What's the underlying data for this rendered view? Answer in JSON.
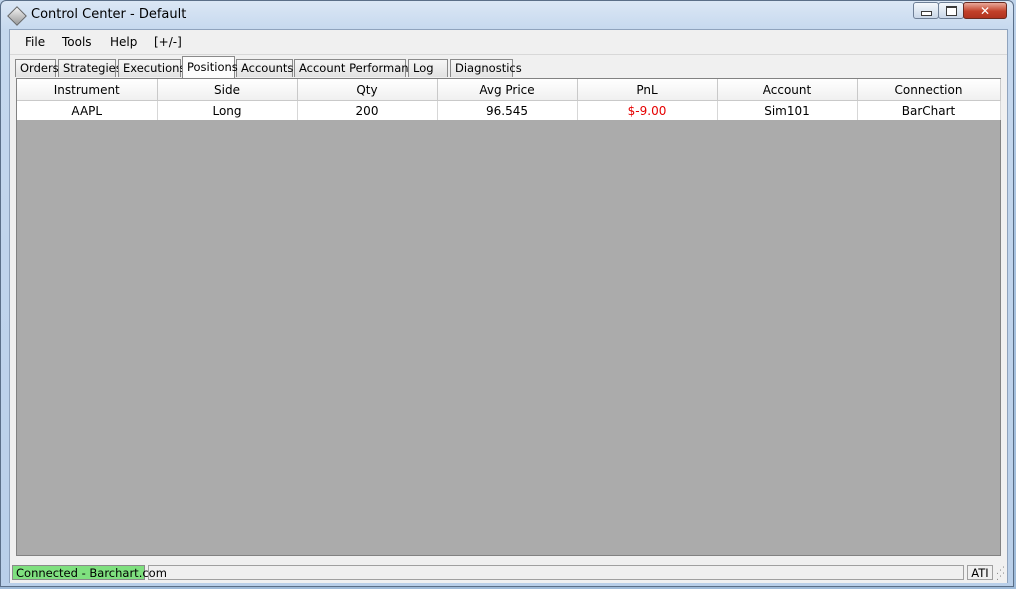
{
  "window": {
    "title": "Control Center - Default"
  },
  "menu": [
    "File",
    "Tools",
    "Help",
    "[+/-]"
  ],
  "tabs": [
    {
      "label": "Orders",
      "active": false
    },
    {
      "label": "Strategies",
      "active": false
    },
    {
      "label": "Executions",
      "active": false
    },
    {
      "label": "Positions",
      "active": true
    },
    {
      "label": "Accounts",
      "active": false
    },
    {
      "label": "Account Performance",
      "active": false
    },
    {
      "label": "Log",
      "active": false
    },
    {
      "label": "Diagnostics",
      "active": false
    }
  ],
  "positions": {
    "columns": [
      "Instrument",
      "Side",
      "Qty",
      "Avg Price",
      "PnL",
      "Account",
      "Connection"
    ],
    "rows": [
      {
        "instrument": "AAPL",
        "side": "Long",
        "qty": "200",
        "avg_price": "96.545",
        "pnl": "$-9.00",
        "account": "Sim101",
        "connection": "BarChart"
      }
    ]
  },
  "status": {
    "connection_text": "Connected - Barchart.com",
    "connection_color": "#7fe07f",
    "ati": "ATI"
  },
  "colors": {
    "pnl_negative": "#e60000",
    "grid_background": "#ababab"
  }
}
